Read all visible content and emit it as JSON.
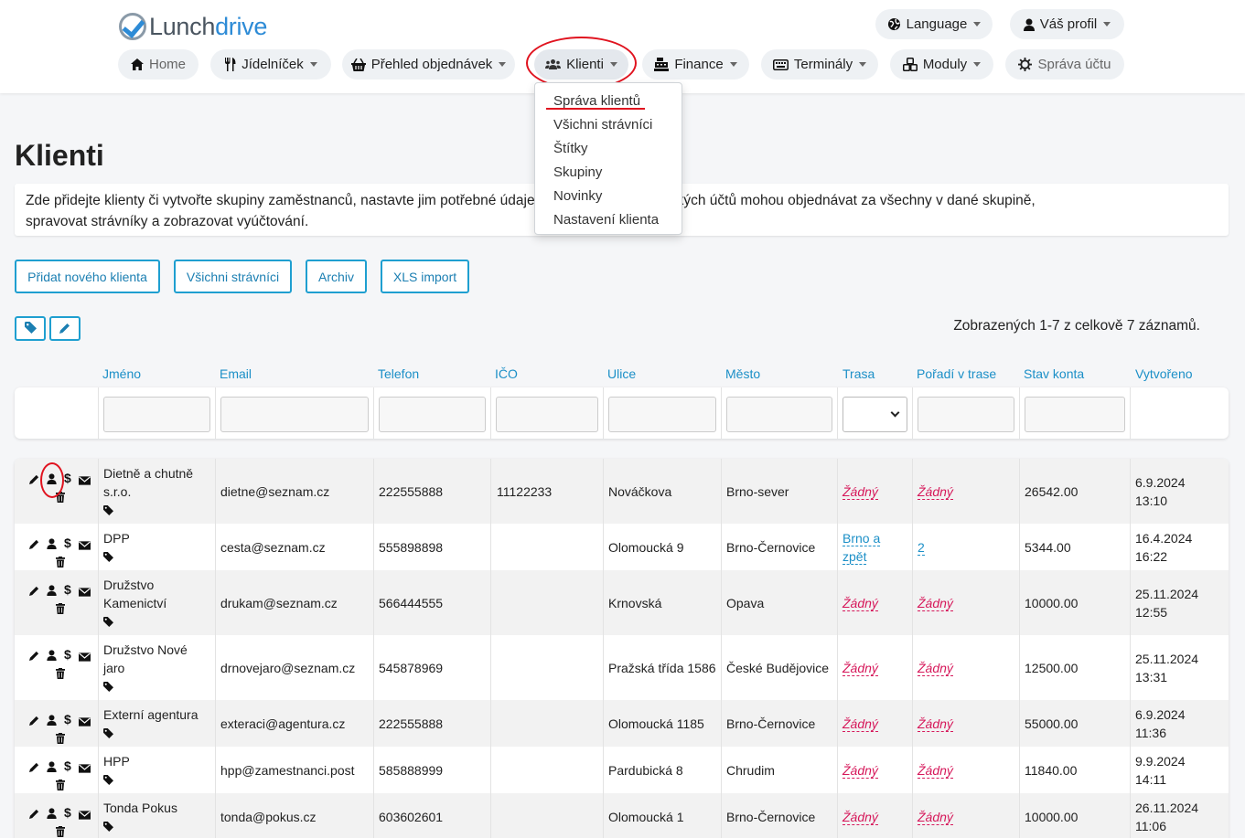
{
  "header": {
    "logo": {
      "part1": "Lunch",
      "part2": "drive"
    },
    "language_label": "Language",
    "profile_label": "Váš profil",
    "nav": {
      "home": "Home",
      "menu": "Jídelníček",
      "orders": "Přehled objednávek",
      "clients": "Klienti",
      "finance": "Finance",
      "terminals": "Terminály",
      "modules": "Moduly",
      "account": "Správa účtu"
    }
  },
  "clients_dropdown": {
    "items": [
      "Správa klientů",
      "Všichni strávníci",
      "Štítky",
      "Skupiny",
      "Novinky",
      "Nastavení klienta"
    ]
  },
  "page": {
    "title": "Klienti",
    "info_line1": "Zde přidejte klienty či vytvořte skupiny zaměstnanců, nastavte jim potřebné údaje. Správci těchto klientských účtů mohou objednávat za všechny v dané skupině,",
    "info_line2": "spravovat strávníky a zobrazovat vyúčtování."
  },
  "buttons": {
    "add_client": "Přidat nového klienta",
    "all_diners": "Všichni strávníci",
    "archive": "Archiv",
    "xls_import": "XLS import"
  },
  "count_text": "Zobrazených 1-7 z celkově 7 záznamů.",
  "columns": {
    "name": "Jméno",
    "email": "Email",
    "phone": "Telefon",
    "ico": "IČO",
    "street": "Ulice",
    "city": "Město",
    "route": "Trasa",
    "order": "Pořadí v trase",
    "balance": "Stav konta",
    "created": "Vytvořeno"
  },
  "rows": [
    {
      "name1": "Dietně a chutně",
      "name2": "s.r.o.",
      "email": "dietne@seznam.cz",
      "phone": "222555888",
      "ico": "11122233",
      "street": "Nováčkova",
      "city": "Brno-sever",
      "route1": "Žádný",
      "route2": "",
      "order": "Žádný",
      "balance": "26542.00",
      "date": "6.9.2024",
      "time": "13:10"
    },
    {
      "name1": "DPP",
      "name2": "",
      "email": "cesta@seznam.cz",
      "phone": "555898898",
      "ico": "",
      "street": "Olomoucká 9",
      "city": "Brno-Černovice",
      "route1": "Brno a",
      "route2": "zpět",
      "order": "2",
      "balance": "5344.00",
      "date": "16.4.2024",
      "time": "16:22"
    },
    {
      "name1": "Družstvo",
      "name2": "Kamenictví",
      "email": "drukam@seznam.cz",
      "phone": "566444555",
      "ico": "",
      "street": "Krnovská",
      "city": "Opava",
      "route1": "Žádný",
      "route2": "",
      "order": "Žádný",
      "balance": "10000.00",
      "date": "25.11.2024",
      "time": "12:55"
    },
    {
      "name1": "Družstvo Nové",
      "name2": "jaro",
      "email": "drnovejaro@seznam.cz",
      "phone": "545878969",
      "ico": "",
      "street": "Pražská třída 1586",
      "city": "České Budějovice",
      "route1": "Žádný",
      "route2": "",
      "order": "Žádný",
      "balance": "12500.00",
      "date": "25.11.2024",
      "time": "13:31"
    },
    {
      "name1": "Externí agentura",
      "name2": "",
      "email": "exteraci@agentura.cz",
      "phone": "222555888",
      "ico": "",
      "street": "Olomoucká 1185",
      "city": "Brno-Černovice",
      "route1": "Žádný",
      "route2": "",
      "order": "Žádný",
      "balance": "55000.00",
      "date": "6.9.2024",
      "time": "11:36"
    },
    {
      "name1": "HPP",
      "name2": "",
      "email": "hpp@zamestnanci.post",
      "phone": "585888999",
      "ico": "",
      "street": "Pardubická 8",
      "city": "Chrudim",
      "route1": "Žádný",
      "route2": "",
      "order": "Žádný",
      "balance": "11840.00",
      "date": "9.9.2024",
      "time": "14:11"
    },
    {
      "name1": "Tonda Pokus",
      "name2": "",
      "email": "tonda@pokus.cz",
      "phone": "603602601",
      "ico": "",
      "street": "Olomoucká 1",
      "city": "Brno-Černovice",
      "route1": "Žádný",
      "route2": "",
      "order": "Žádný",
      "balance": "10000.00",
      "date": "26.11.2024",
      "time": "11:06"
    }
  ],
  "icons": {
    "row_actions": [
      "pencil-icon",
      "user-icon",
      "dollar-icon",
      "envelope-icon",
      "trash-icon",
      "tag-icon"
    ],
    "dollar_glyph": "$"
  },
  "colors": {
    "accent": "#1f9fd0",
    "link_red": "#d6185a",
    "annotation_red": "#e0131f"
  }
}
